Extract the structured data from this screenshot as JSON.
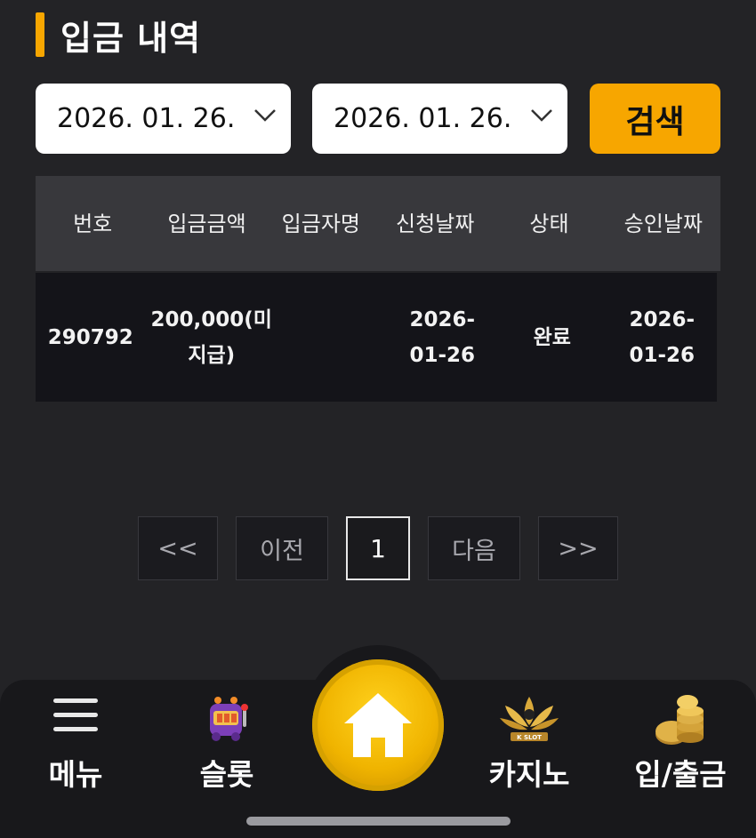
{
  "page_title": "입금 내역",
  "filters": {
    "start_date": "2026. 01. 26.",
    "end_date": "2026. 01. 26.",
    "search_label": "검색"
  },
  "table": {
    "columns": [
      "번호",
      "입금금액",
      "입금자명",
      "신청날짜",
      "상태",
      "승인날짜"
    ],
    "rows": [
      {
        "no": "290792",
        "amount": "200,000(미지급)",
        "depositor": "",
        "request_date": "2026-01-26",
        "status": "완료",
        "approve_date": "2026-01-26"
      }
    ]
  },
  "pagination": {
    "first": "<<",
    "prev": "이전",
    "current": "1",
    "next": "다음",
    "last": ">>"
  },
  "bottom_nav": {
    "menu": "메뉴",
    "slot": "슬롯",
    "casino": "카지노",
    "deposit_withdraw": "입/출금",
    "casino_logo_text": "K SLOT"
  },
  "colors": {
    "accent": "#f7a600",
    "background": "#232326",
    "nav": "#18181b"
  }
}
